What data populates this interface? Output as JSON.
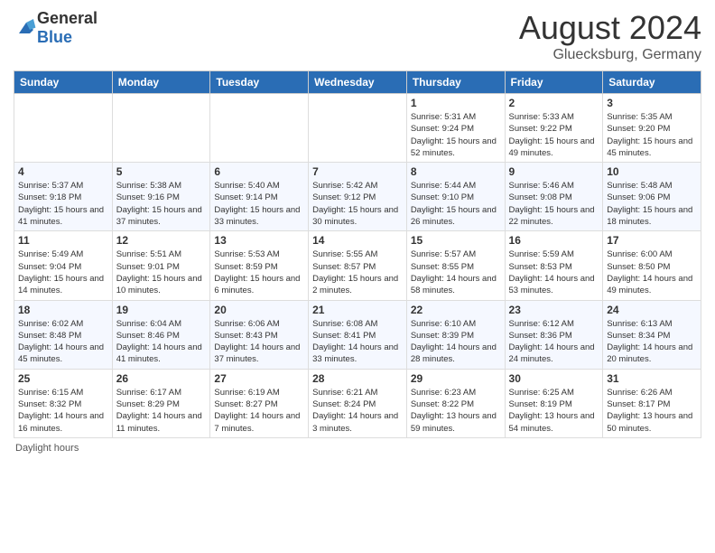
{
  "header": {
    "logo": {
      "general": "General",
      "blue": "Blue"
    },
    "title": "August 2024",
    "location": "Gluecksburg, Germany"
  },
  "calendar": {
    "days_of_week": [
      "Sunday",
      "Monday",
      "Tuesday",
      "Wednesday",
      "Thursday",
      "Friday",
      "Saturday"
    ],
    "weeks": [
      [
        {
          "day": "",
          "info": ""
        },
        {
          "day": "",
          "info": ""
        },
        {
          "day": "",
          "info": ""
        },
        {
          "day": "",
          "info": ""
        },
        {
          "day": "1",
          "info": "Sunrise: 5:31 AM\nSunset: 9:24 PM\nDaylight: 15 hours and 52 minutes."
        },
        {
          "day": "2",
          "info": "Sunrise: 5:33 AM\nSunset: 9:22 PM\nDaylight: 15 hours and 49 minutes."
        },
        {
          "day": "3",
          "info": "Sunrise: 5:35 AM\nSunset: 9:20 PM\nDaylight: 15 hours and 45 minutes."
        }
      ],
      [
        {
          "day": "4",
          "info": "Sunrise: 5:37 AM\nSunset: 9:18 PM\nDaylight: 15 hours and 41 minutes."
        },
        {
          "day": "5",
          "info": "Sunrise: 5:38 AM\nSunset: 9:16 PM\nDaylight: 15 hours and 37 minutes."
        },
        {
          "day": "6",
          "info": "Sunrise: 5:40 AM\nSunset: 9:14 PM\nDaylight: 15 hours and 33 minutes."
        },
        {
          "day": "7",
          "info": "Sunrise: 5:42 AM\nSunset: 9:12 PM\nDaylight: 15 hours and 30 minutes."
        },
        {
          "day": "8",
          "info": "Sunrise: 5:44 AM\nSunset: 9:10 PM\nDaylight: 15 hours and 26 minutes."
        },
        {
          "day": "9",
          "info": "Sunrise: 5:46 AM\nSunset: 9:08 PM\nDaylight: 15 hours and 22 minutes."
        },
        {
          "day": "10",
          "info": "Sunrise: 5:48 AM\nSunset: 9:06 PM\nDaylight: 15 hours and 18 minutes."
        }
      ],
      [
        {
          "day": "11",
          "info": "Sunrise: 5:49 AM\nSunset: 9:04 PM\nDaylight: 15 hours and 14 minutes."
        },
        {
          "day": "12",
          "info": "Sunrise: 5:51 AM\nSunset: 9:01 PM\nDaylight: 15 hours and 10 minutes."
        },
        {
          "day": "13",
          "info": "Sunrise: 5:53 AM\nSunset: 8:59 PM\nDaylight: 15 hours and 6 minutes."
        },
        {
          "day": "14",
          "info": "Sunrise: 5:55 AM\nSunset: 8:57 PM\nDaylight: 15 hours and 2 minutes."
        },
        {
          "day": "15",
          "info": "Sunrise: 5:57 AM\nSunset: 8:55 PM\nDaylight: 14 hours and 58 minutes."
        },
        {
          "day": "16",
          "info": "Sunrise: 5:59 AM\nSunset: 8:53 PM\nDaylight: 14 hours and 53 minutes."
        },
        {
          "day": "17",
          "info": "Sunrise: 6:00 AM\nSunset: 8:50 PM\nDaylight: 14 hours and 49 minutes."
        }
      ],
      [
        {
          "day": "18",
          "info": "Sunrise: 6:02 AM\nSunset: 8:48 PM\nDaylight: 14 hours and 45 minutes."
        },
        {
          "day": "19",
          "info": "Sunrise: 6:04 AM\nSunset: 8:46 PM\nDaylight: 14 hours and 41 minutes."
        },
        {
          "day": "20",
          "info": "Sunrise: 6:06 AM\nSunset: 8:43 PM\nDaylight: 14 hours and 37 minutes."
        },
        {
          "day": "21",
          "info": "Sunrise: 6:08 AM\nSunset: 8:41 PM\nDaylight: 14 hours and 33 minutes."
        },
        {
          "day": "22",
          "info": "Sunrise: 6:10 AM\nSunset: 8:39 PM\nDaylight: 14 hours and 28 minutes."
        },
        {
          "day": "23",
          "info": "Sunrise: 6:12 AM\nSunset: 8:36 PM\nDaylight: 14 hours and 24 minutes."
        },
        {
          "day": "24",
          "info": "Sunrise: 6:13 AM\nSunset: 8:34 PM\nDaylight: 14 hours and 20 minutes."
        }
      ],
      [
        {
          "day": "25",
          "info": "Sunrise: 6:15 AM\nSunset: 8:32 PM\nDaylight: 14 hours and 16 minutes."
        },
        {
          "day": "26",
          "info": "Sunrise: 6:17 AM\nSunset: 8:29 PM\nDaylight: 14 hours and 11 minutes."
        },
        {
          "day": "27",
          "info": "Sunrise: 6:19 AM\nSunset: 8:27 PM\nDaylight: 14 hours and 7 minutes."
        },
        {
          "day": "28",
          "info": "Sunrise: 6:21 AM\nSunset: 8:24 PM\nDaylight: 14 hours and 3 minutes."
        },
        {
          "day": "29",
          "info": "Sunrise: 6:23 AM\nSunset: 8:22 PM\nDaylight: 13 hours and 59 minutes."
        },
        {
          "day": "30",
          "info": "Sunrise: 6:25 AM\nSunset: 8:19 PM\nDaylight: 13 hours and 54 minutes."
        },
        {
          "day": "31",
          "info": "Sunrise: 6:26 AM\nSunset: 8:17 PM\nDaylight: 13 hours and 50 minutes."
        }
      ]
    ]
  },
  "footer": {
    "text": "Daylight hours",
    "link": "GeneralBlue.com"
  }
}
